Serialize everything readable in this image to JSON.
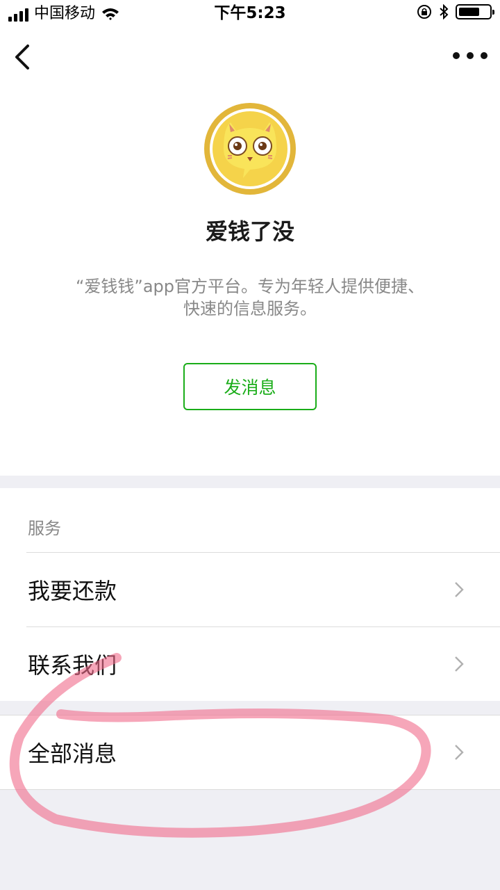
{
  "status_bar": {
    "carrier": "中国移动",
    "time": "下午5:23",
    "battery_level": 0.7,
    "icons": [
      "signal-icon",
      "wifi-icon",
      "orientation-lock-icon",
      "bluetooth-icon",
      "battery-icon"
    ]
  },
  "nav": {
    "back_icon": "chevron-left-icon",
    "more_icon": "more-dots-icon"
  },
  "profile": {
    "avatar_icon": "cartoon-cat-logo",
    "name": "爱钱了没",
    "description": "“爱钱钱”app官方平台。专为年轻人提供便捷、快速的信息服务。",
    "send_button_label": "发消息"
  },
  "services": {
    "section_title": "服务",
    "items": [
      {
        "label": "我要还款"
      },
      {
        "label": "联系我们"
      }
    ]
  },
  "messages": {
    "label": "全部消息"
  },
  "colors": {
    "accent_green": "#1aad19",
    "annotation_pink": "#f06a8a",
    "background": "#efeff4"
  }
}
